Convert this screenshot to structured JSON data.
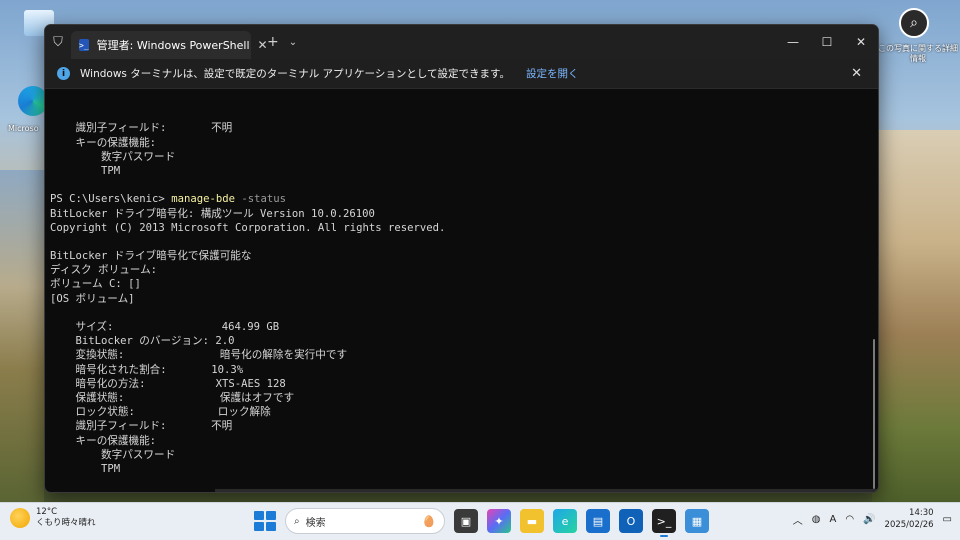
{
  "desktop": {
    "left_icon_label": "Microso",
    "spotlight_label": "この写真に関する詳細情報"
  },
  "window": {
    "tab_title": "管理者: Windows PowerShell",
    "new_tab": "+",
    "dropdown": "⌄",
    "controls": {
      "minimize": "—",
      "maximize": "☐",
      "close": "✕"
    }
  },
  "infobar": {
    "message": "Windows ターミナルは、設定で既定のターミナル アプリケーションとして設定できます。",
    "link": "設定を開く",
    "close": "✕"
  },
  "console": {
    "lines": [
      {
        "text": "    識別子フィールド:       不明"
      },
      {
        "text": "    キーの保護機能:"
      },
      {
        "text": "        数字パスワード"
      },
      {
        "text": "        TPM"
      },
      {
        "text": ""
      },
      {
        "prompt": "PS C:\\Users\\kenic> ",
        "cmd": "manage-bde",
        "param": " -status"
      },
      {
        "text": "BitLocker ドライブ暗号化: 構成ツール Version 10.0.26100"
      },
      {
        "text": "Copyright (C) 2013 Microsoft Corporation. All rights reserved."
      },
      {
        "text": ""
      },
      {
        "text": "BitLocker ドライブ暗号化で保護可能な"
      },
      {
        "text": "ディスク ボリューム:"
      },
      {
        "text": "ボリューム C: []"
      },
      {
        "text": "[OS ボリューム]"
      },
      {
        "text": ""
      },
      {
        "text": "    サイズ:                 464.99 GB"
      },
      {
        "text": "    BitLocker のバージョン: 2.0"
      },
      {
        "text": "    変換状態:               暗号化の解除を実行中です"
      },
      {
        "text": "    暗号化された割合:       10.3%"
      },
      {
        "text": "    暗号化の方法:           XTS-AES 128"
      },
      {
        "text": "    保護状態:               保護はオフです"
      },
      {
        "text": "    ロック状態:             ロック解除"
      },
      {
        "text": "    識別子フィールド:       不明"
      },
      {
        "text": "    キーの保護機能:"
      },
      {
        "text": "        数字パスワード"
      },
      {
        "text": "        TPM"
      },
      {
        "text": ""
      },
      {
        "prompt": "PS C:\\Users\\kenic> "
      }
    ]
  },
  "taskbar": {
    "weather_temp": "12°C",
    "weather_desc": "くもり時々晴れ",
    "search_placeholder": "検索",
    "tray_ime": "A",
    "clock_time": "14:30",
    "clock_date": "2025/02/26"
  },
  "colors": {
    "terminal_bg": "#0c0c0c",
    "command": "#f5f0a0",
    "parameter": "#9a9a9a",
    "link": "#7ab7ff"
  }
}
